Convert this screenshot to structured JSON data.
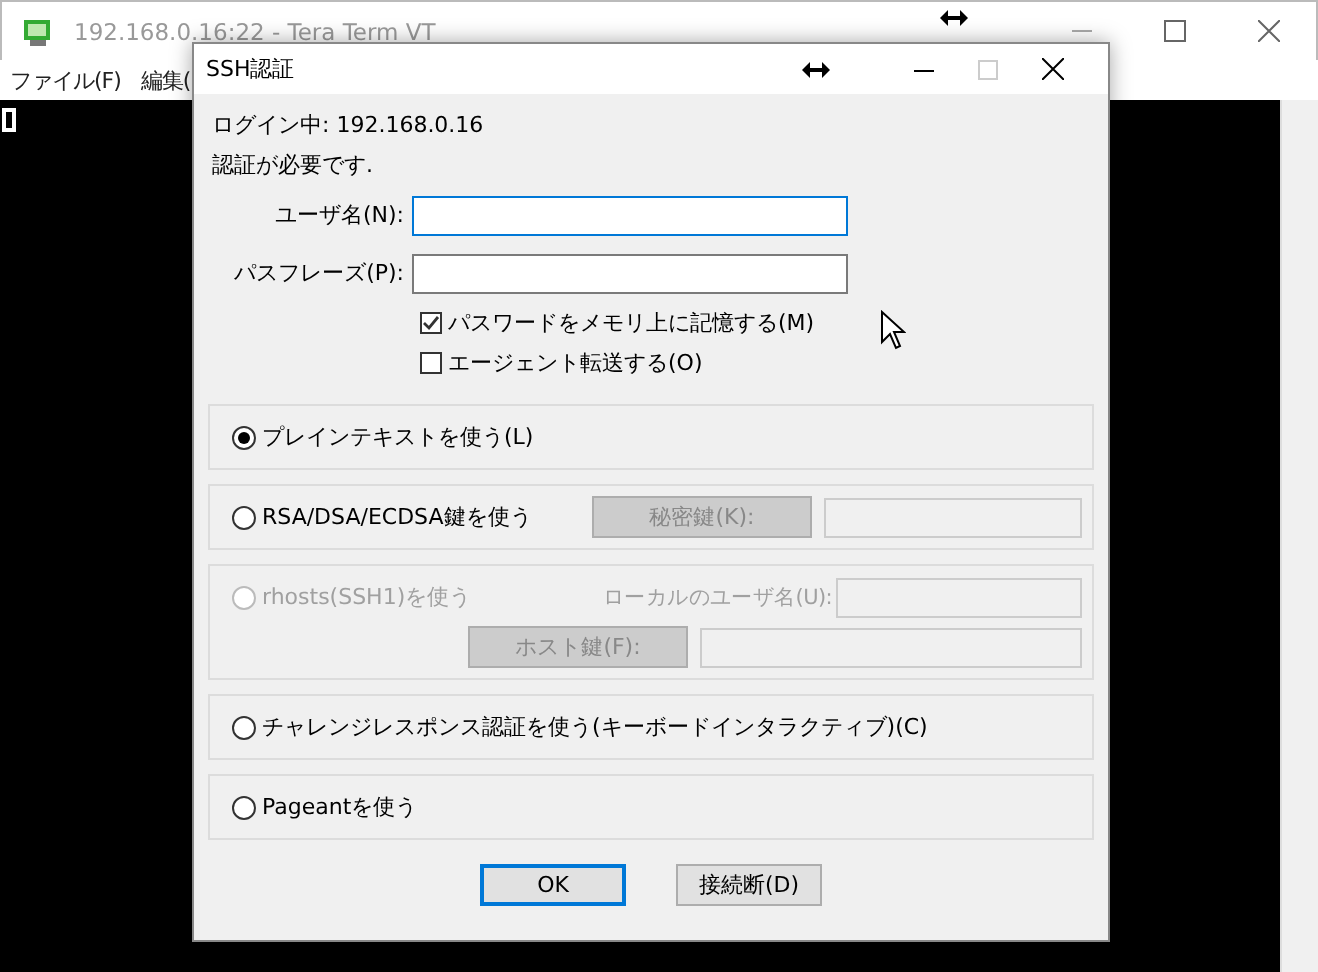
{
  "terminal_window": {
    "title": "192.168.0.16:22 - Tera Term VT",
    "menu": [
      {
        "label": "ファイル(F)"
      },
      {
        "label": "編集("
      }
    ]
  },
  "dialog": {
    "title": "SSH認証",
    "login_line": "ログイン中: 192.168.0.16",
    "message": "認証が必要です.",
    "fields": [
      {
        "label": "ユーザ名(N):",
        "focused": true
      },
      {
        "label": "パスフレーズ(P):",
        "focused": false
      }
    ],
    "checkboxes": [
      {
        "label": "パスワードをメモリ上に記憶する(M)",
        "checked": true
      },
      {
        "label": "エージェント転送する(O)",
        "checked": false
      }
    ],
    "methods": [
      {
        "label": "プレインテキストを使う(L)",
        "selected": true,
        "disabled": false
      },
      {
        "label": "RSA/DSA/ECDSA鍵を使う",
        "selected": false,
        "disabled": false,
        "lines": [
          [
            {
              "kind": "button",
              "label": "秘密鍵(K):"
            },
            {
              "kind": "field"
            }
          ]
        ]
      },
      {
        "label": "rhosts(SSH1)を使う",
        "selected": false,
        "disabled": true,
        "lines": [
          [
            {
              "kind": "label",
              "label": "ローカルのユーザ名(U):"
            },
            {
              "kind": "field"
            }
          ],
          [
            {
              "kind": "button",
              "label": "ホスト鍵(F):"
            },
            {
              "kind": "field"
            }
          ]
        ]
      },
      {
        "label": "チャレンジレスポンス認証を使う(キーボードインタラクティブ)(C)",
        "selected": false,
        "disabled": false
      },
      {
        "label": "Pageantを使う",
        "selected": false,
        "disabled": false
      }
    ],
    "buttons": [
      {
        "label": "OK",
        "default": true
      },
      {
        "label": "接続断(D)",
        "default": false
      }
    ]
  }
}
